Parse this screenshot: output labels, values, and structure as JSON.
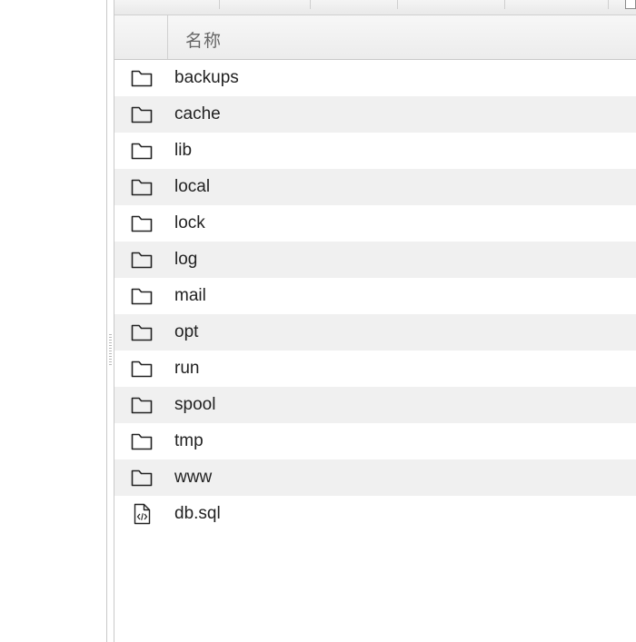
{
  "file_list": {
    "header": {
      "name_column": "名称"
    },
    "items": [
      {
        "name": "backups",
        "icon": "folder-icon",
        "type": "folder"
      },
      {
        "name": "cache",
        "icon": "folder-icon",
        "type": "folder"
      },
      {
        "name": "lib",
        "icon": "folder-icon",
        "type": "folder"
      },
      {
        "name": "local",
        "icon": "folder-icon",
        "type": "folder"
      },
      {
        "name": "lock",
        "icon": "folder-icon",
        "type": "folder"
      },
      {
        "name": "log",
        "icon": "folder-icon",
        "type": "folder"
      },
      {
        "name": "mail",
        "icon": "folder-icon",
        "type": "folder"
      },
      {
        "name": "opt",
        "icon": "folder-icon",
        "type": "folder"
      },
      {
        "name": "run",
        "icon": "folder-icon",
        "type": "folder"
      },
      {
        "name": "spool",
        "icon": "folder-icon",
        "type": "folder"
      },
      {
        "name": "tmp",
        "icon": "folder-icon",
        "type": "folder"
      },
      {
        "name": "www",
        "icon": "folder-icon",
        "type": "folder"
      },
      {
        "name": "db.sql",
        "icon": "code-file-icon",
        "type": "file"
      }
    ]
  },
  "colors": {
    "row_alt_background": "#f0f0f0",
    "header_background": "#ececec",
    "icon_stroke": "#222222"
  }
}
